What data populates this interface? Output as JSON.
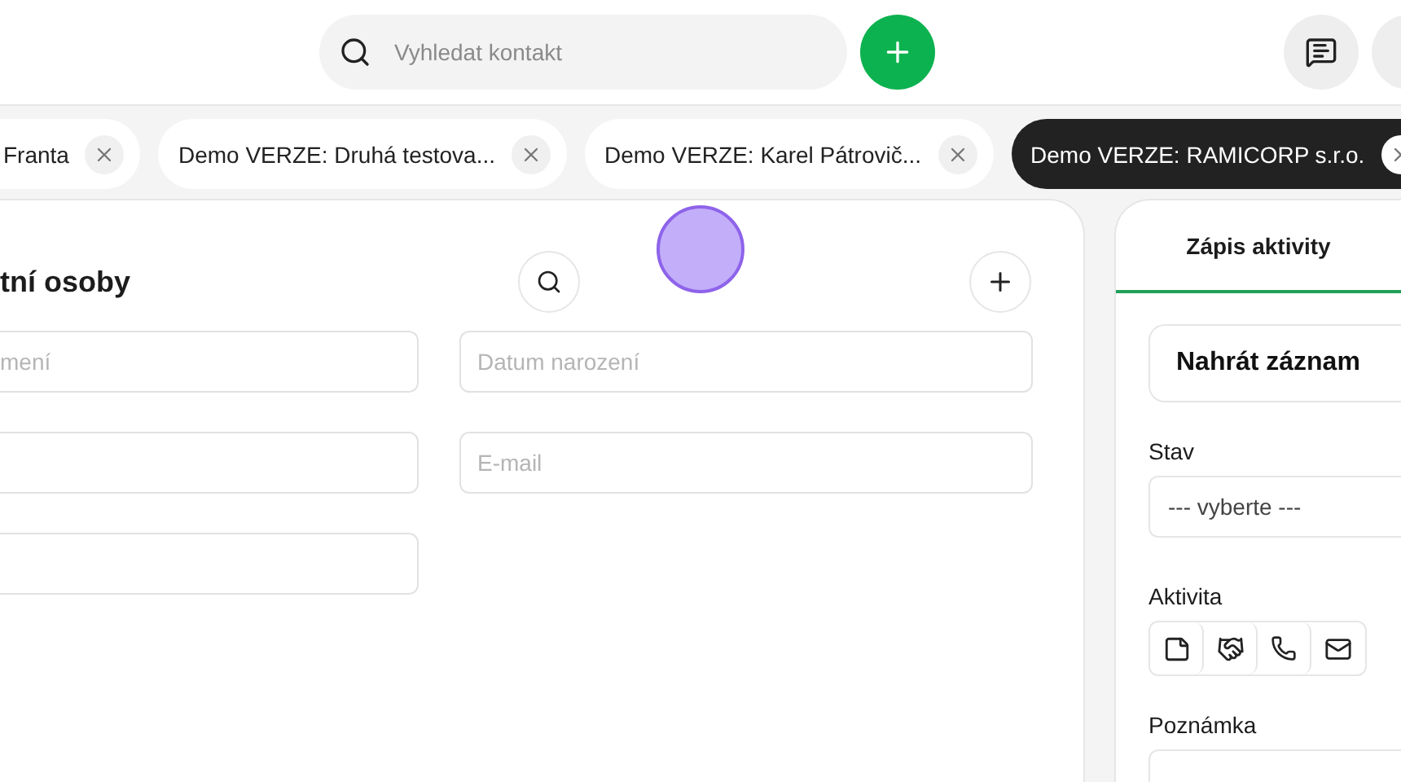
{
  "top_bar": {
    "search": {
      "placeholder": "Vyhledat kontakt"
    }
  },
  "tabs": [
    {
      "label": "Franta",
      "selected": false
    },
    {
      "label": "Demo VERZE: Druhá testova...",
      "selected": false
    },
    {
      "label": "Demo VERZE: Karel Pátrovič...",
      "selected": false
    },
    {
      "label": "Demo VERZE: RAMICORP s.r.o.",
      "selected": true
    }
  ],
  "contact_form": {
    "title": "tní osoby",
    "fields": [
      {
        "kind": "text",
        "placeholder": "mení"
      },
      {
        "kind": "text",
        "placeholder": "Datum narození"
      },
      {
        "kind": "text"
      },
      {
        "kind": "text",
        "placeholder": "E-mail"
      },
      {
        "kind": "text"
      }
    ]
  },
  "activity_panel": {
    "tabs": [
      {
        "label": "Zápis aktivity",
        "selected": true
      }
    ],
    "upload": "Nahrát záznam",
    "status": {
      "label": "Stav",
      "value": "--- vyberte ---"
    },
    "activity": {
      "label": "Aktivita"
    },
    "note": {
      "label": "Poznámka"
    }
  }
}
